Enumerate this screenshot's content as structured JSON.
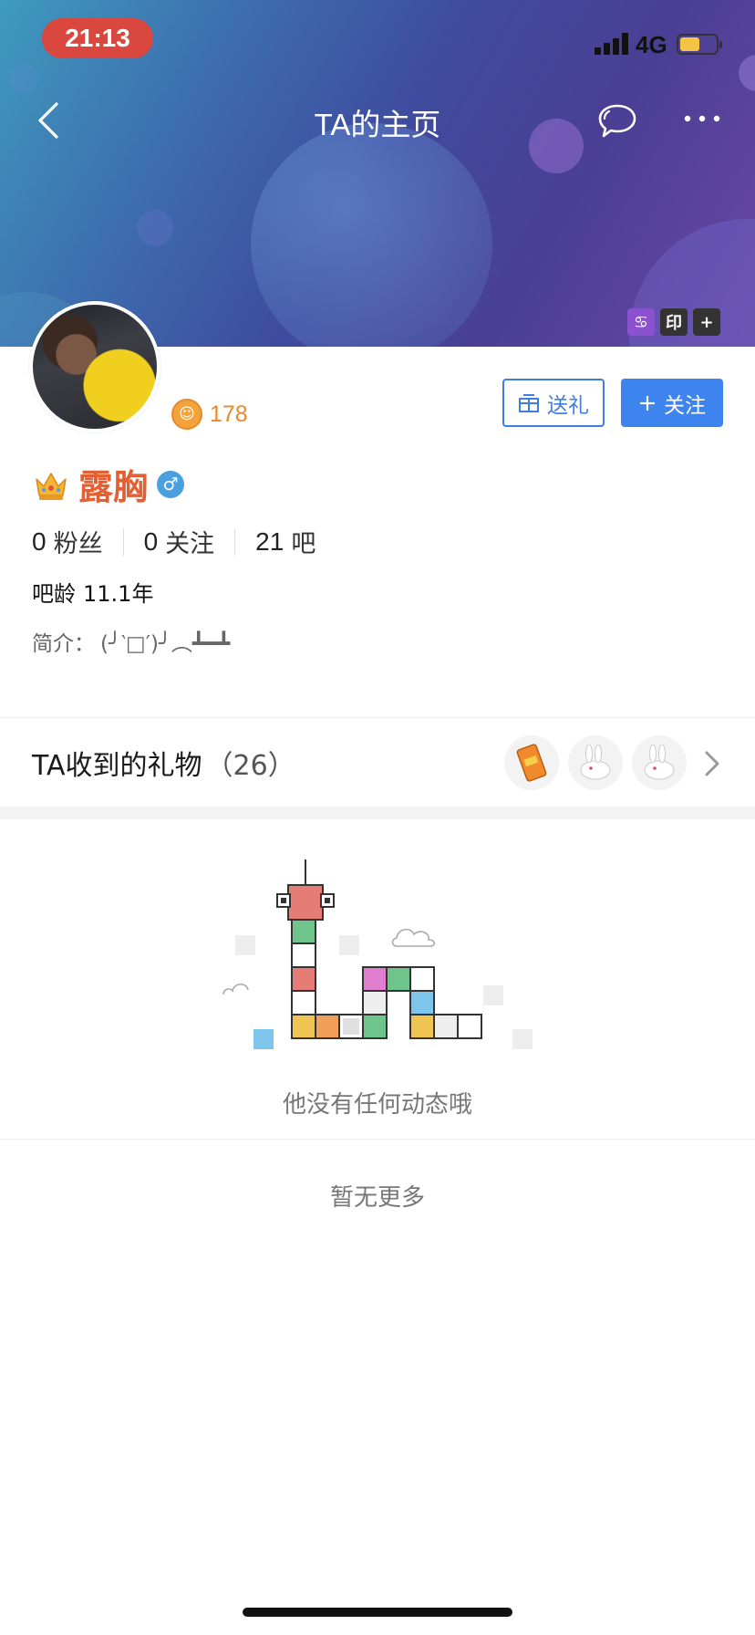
{
  "status_bar": {
    "time": "21:13",
    "network": "4G",
    "battery_color": "#f6c444"
  },
  "nav": {
    "title": "TA的主页",
    "back_icon": "chevron-left-icon",
    "chat_icon": "chat-bubble-icon",
    "more_icon": "more-dots-icon"
  },
  "header_tags": [
    {
      "name": "cancer-zodiac-icon",
      "glyph": "♋",
      "color": "#8a52d0"
    },
    {
      "name": "seal-tag",
      "glyph": "印",
      "color": "#333333"
    },
    {
      "name": "add-tag",
      "glyph": "+",
      "color": "#333333"
    }
  ],
  "profile": {
    "level": "178",
    "gift_button": "送礼",
    "follow_button": "关注",
    "username": "露胸",
    "name_color": "#e36034",
    "stats": [
      {
        "num": "0",
        "label": "粉丝"
      },
      {
        "num": "0",
        "label": "关注"
      },
      {
        "num": "21",
        "label": "吧"
      }
    ],
    "bar_age_label": "吧龄",
    "bar_age_value": "11.1年",
    "bio_label": "简介：",
    "bio_value": "(╯‵□′)╯︵┻━┻"
  },
  "gifts": {
    "title": "TA收到的礼物",
    "count": "（26）"
  },
  "empty_state": {
    "message": "他没有任何动态哦",
    "no_more": "暂无更多"
  },
  "colors": {
    "accent_blue": "#3d84ef",
    "level_orange": "#e8892a"
  }
}
